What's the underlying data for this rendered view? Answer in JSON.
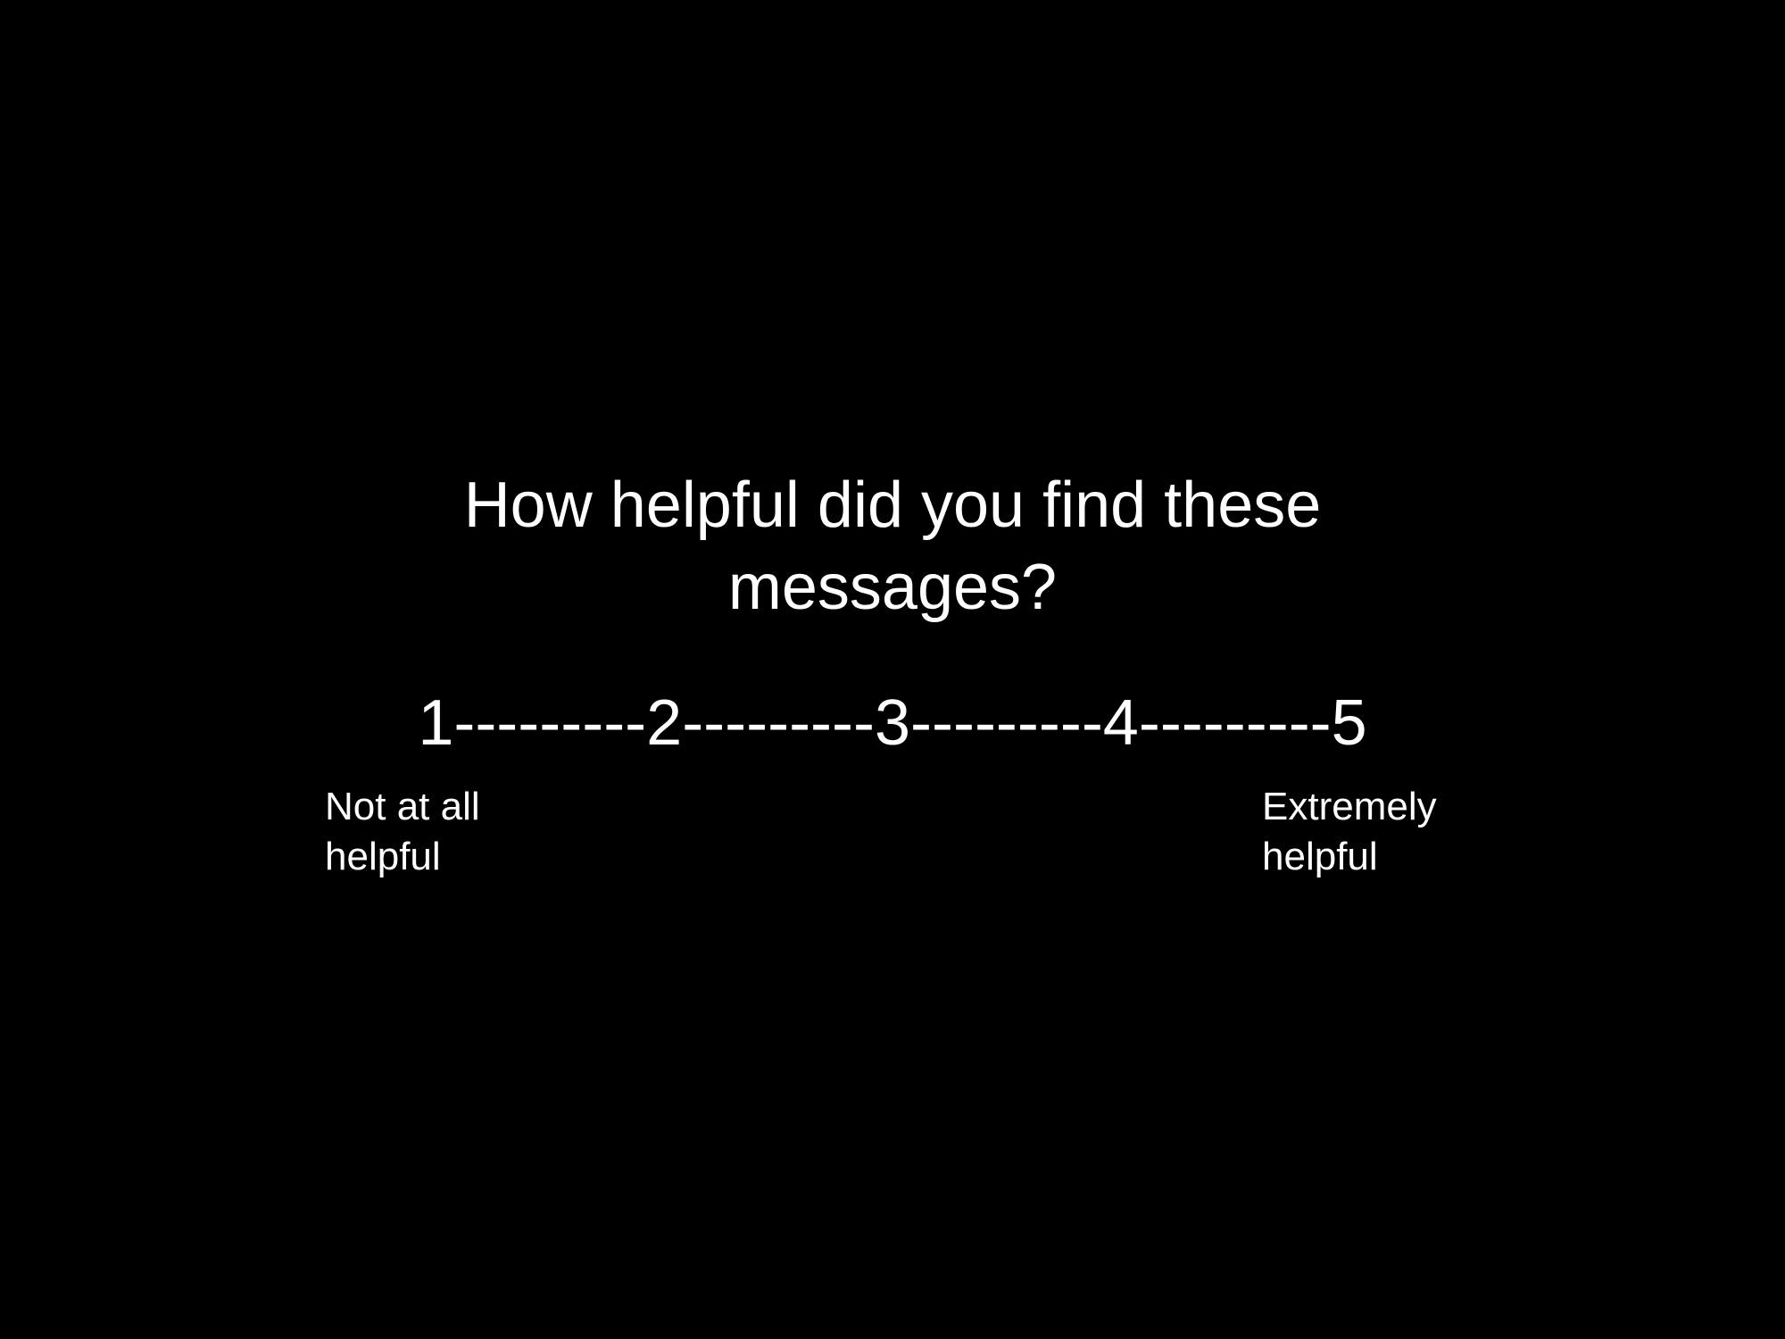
{
  "slide": {
    "background_color": "#000000",
    "text_color": "#ffffff",
    "question": "How helpful did you find these\nmessages?",
    "scale": {
      "line": "1---------2---------3---------4---------5",
      "min": 1,
      "max": 5
    },
    "anchors": {
      "low": "Not at all\nhelpful",
      "high": "Extremely\nhelpful"
    }
  }
}
